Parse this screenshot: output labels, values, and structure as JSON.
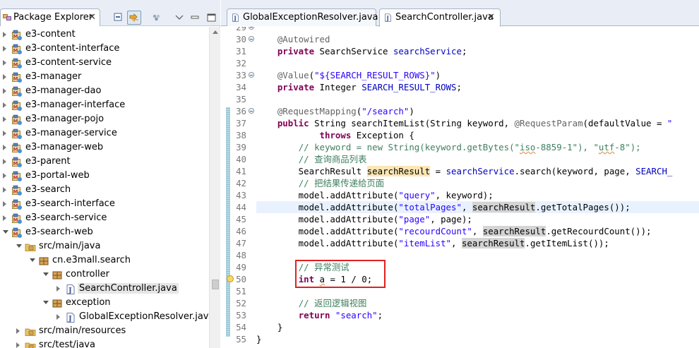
{
  "explorer": {
    "title": "Package Explorer",
    "close_glyph": "✕",
    "toolbar": [
      "collapse-all-icon",
      "link-with-editor-icon",
      "view-menu-icon",
      "chevron-down-icon",
      "minimize-icon",
      "maximize-icon"
    ],
    "tree": [
      {
        "label": "e3-content",
        "depth": 0,
        "state": "closed",
        "icon": "maven-project-icon"
      },
      {
        "label": "e3-content-interface",
        "depth": 0,
        "state": "closed",
        "icon": "maven-project-icon"
      },
      {
        "label": "e3-content-service",
        "depth": 0,
        "state": "closed",
        "icon": "maven-project-icon"
      },
      {
        "label": "e3-manager",
        "depth": 0,
        "state": "closed",
        "icon": "maven-project-icon"
      },
      {
        "label": "e3-manager-dao",
        "depth": 0,
        "state": "closed",
        "icon": "maven-project-icon"
      },
      {
        "label": "e3-manager-interface",
        "depth": 0,
        "state": "closed",
        "icon": "maven-project-icon"
      },
      {
        "label": "e3-manager-pojo",
        "depth": 0,
        "state": "closed",
        "icon": "maven-project-icon"
      },
      {
        "label": "e3-manager-service",
        "depth": 0,
        "state": "closed",
        "icon": "maven-project-icon"
      },
      {
        "label": "e3-manager-web",
        "depth": 0,
        "state": "closed",
        "icon": "maven-project-icon"
      },
      {
        "label": "e3-parent",
        "depth": 0,
        "state": "closed",
        "icon": "maven-project-icon"
      },
      {
        "label": "e3-portal-web",
        "depth": 0,
        "state": "closed",
        "icon": "maven-project-icon"
      },
      {
        "label": "e3-search",
        "depth": 0,
        "state": "closed",
        "icon": "maven-project-icon"
      },
      {
        "label": "e3-search-interface",
        "depth": 0,
        "state": "closed",
        "icon": "maven-project-icon"
      },
      {
        "label": "e3-search-service",
        "depth": 0,
        "state": "closed",
        "icon": "maven-project-icon"
      },
      {
        "label": "e3-search-web",
        "depth": 0,
        "state": "open",
        "icon": "maven-project-icon"
      },
      {
        "label": "src/main/java",
        "depth": 1,
        "state": "open",
        "icon": "source-folder-icon"
      },
      {
        "label": "cn.e3mall.search",
        "depth": 2,
        "state": "open",
        "icon": "package-icon"
      },
      {
        "label": "controller",
        "depth": 3,
        "state": "open",
        "icon": "package-icon"
      },
      {
        "label": "SearchController.java",
        "depth": 4,
        "state": "closed",
        "icon": "java-file-icon",
        "selected": true
      },
      {
        "label": "exception",
        "depth": 3,
        "state": "open",
        "icon": "package-icon"
      },
      {
        "label": "GlobalExceptionResolver.java",
        "depth": 4,
        "state": "closed",
        "icon": "java-file-icon"
      },
      {
        "label": "src/main/resources",
        "depth": 1,
        "state": "closed",
        "icon": "source-folder-icon"
      },
      {
        "label": "src/test/java",
        "depth": 1,
        "state": "closed",
        "icon": "source-folder-icon"
      }
    ]
  },
  "editor": {
    "tabs": [
      {
        "title": "GlobalExceptionResolver.java",
        "active": false,
        "close": ""
      },
      {
        "title": "SearchController.java",
        "active": true,
        "close": "✕"
      }
    ],
    "lines": [
      {
        "n": "29",
        "fold": true,
        "html": ""
      },
      {
        "n": "30",
        "fold": true,
        "html": "    <span class='ann'>@Autowired</span>"
      },
      {
        "n": "31",
        "html": "    <span class='kw'>private</span> SearchService <span class='fld'>searchService</span>;"
      },
      {
        "n": "32",
        "html": ""
      },
      {
        "n": "33",
        "fold": true,
        "html": "    <span class='ann'>@Value</span>(<span class='str'>\"${SEARCH_RESULT_ROWS}\"</span>)"
      },
      {
        "n": "34",
        "html": "    <span class='kw'>private</span> Integer <span class='fld'>SEARCH_RESULT_ROWS</span>;"
      },
      {
        "n": "35",
        "html": ""
      },
      {
        "n": "36",
        "fold": true,
        "html": "    <span class='ann'>@RequestMapping</span>(<span class='str'>\"/search\"</span>)"
      },
      {
        "n": "37",
        "html": "    <span class='kw'>public</span> String searchItemList(String keyword, <span class='ann'>@RequestParam</span>(defaultValue = <span class='str'>\"</span>"
      },
      {
        "n": "38",
        "html": "            <span class='kw'>throws</span> Exception {"
      },
      {
        "n": "39",
        "html": "        <span class='cmt'>// keyword = new String(keyword.getBytes(\"<span class='sq'>iso</span>-8859-1\"), \"<span class='sq'>utf</span>-8\");</span>"
      },
      {
        "n": "40",
        "html": "        <span class='cmt'>// 查询商品列表</span>"
      },
      {
        "n": "41",
        "html": "        SearchResult <span class='hl'>searchResult</span> = <span class='fld'>searchService</span>.search(keyword, page, <span class='fld'>SEARCH_</span>"
      },
      {
        "n": "42",
        "html": "        <span class='cmt'>// 把结果传递给页面</span>"
      },
      {
        "n": "43",
        "html": "        model.addAttribute(<span class='str'>\"query\"</span>, keyword);"
      },
      {
        "n": "44",
        "current": true,
        "html": "        model.addAttribute(<span class='str'>\"totalPages\"</span>, <span class='occ'>searchResult</span>.getTotalPages());"
      },
      {
        "n": "45",
        "html": "        model.addAttribute(<span class='str'>\"page\"</span>, page);"
      },
      {
        "n": "46",
        "html": "        model.addAttribute(<span class='str'>\"recourdCount\"</span>, <span class='occ'>searchResult</span>.getRecourdCount());"
      },
      {
        "n": "47",
        "html": "        model.addAttribute(<span class='str'>\"itemList\"</span>, <span class='occ'>searchResult</span>.getItemList());"
      },
      {
        "n": "48",
        "html": ""
      },
      {
        "n": "49",
        "html": "        <span class='cmt'>// 异常测试</span>"
      },
      {
        "n": "50",
        "html": "        <span class='kw'>int</span> <span class='sq'>a</span> = 1 / 0;"
      },
      {
        "n": "51",
        "html": ""
      },
      {
        "n": "52",
        "html": "        <span class='cmt'>// 返回逻辑视图</span>"
      },
      {
        "n": "53",
        "html": "        <span class='kw'>return</span> <span class='str'>\"search\"</span>;"
      },
      {
        "n": "54",
        "html": "    }"
      },
      {
        "n": "55",
        "html": "}"
      }
    ]
  }
}
